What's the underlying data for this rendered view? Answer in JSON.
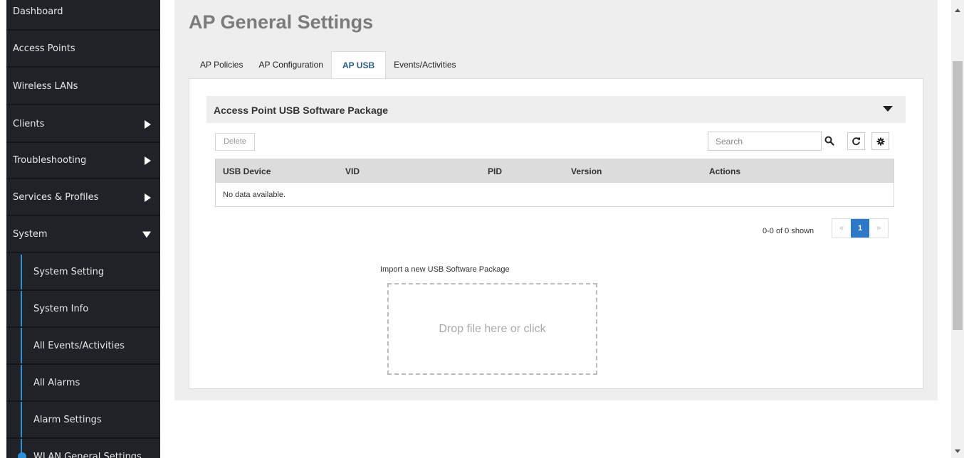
{
  "sidebar": {
    "items": [
      {
        "label": "Dashboard"
      },
      {
        "label": "Access Points"
      },
      {
        "label": "Wireless LANs"
      },
      {
        "label": "Clients"
      },
      {
        "label": "Troubleshooting"
      },
      {
        "label": "Services & Profiles"
      },
      {
        "label": "System"
      }
    ],
    "sub_items": [
      {
        "label": "System Setting"
      },
      {
        "label": "System Info"
      },
      {
        "label": "All Events/Activities"
      },
      {
        "label": "All Alarms"
      },
      {
        "label": "Alarm Settings"
      },
      {
        "label": "WLAN General Settings"
      }
    ]
  },
  "main": {
    "title": "AP General Settings",
    "tabs": [
      {
        "label": "AP Policies"
      },
      {
        "label": "AP Configuration"
      },
      {
        "label": "AP USB"
      },
      {
        "label": "Events/Activities"
      }
    ],
    "active_tab": "AP USB",
    "section_title": "Access Point USB Software Package",
    "delete_label": "Delete",
    "search_placeholder": "Search",
    "table": {
      "columns": [
        "USB Device",
        "VID",
        "PID",
        "Version",
        "Actions"
      ],
      "empty_text": "No data available."
    },
    "pager": {
      "shown_text": "0-0 of 0 shown",
      "prev": "«",
      "page": "1",
      "next": "»"
    },
    "import_label": "Import a new USB Software Package",
    "dropzone_text": "Drop file here or click"
  },
  "colors": {
    "sidebar_bg": "#1f2328",
    "accent": "#2d8fd5",
    "active_page": "#2d79c7"
  },
  "icons": [
    "search-icon",
    "refresh-icon",
    "gear-icon",
    "chevron-down-icon",
    "chevron-right-icon"
  ]
}
